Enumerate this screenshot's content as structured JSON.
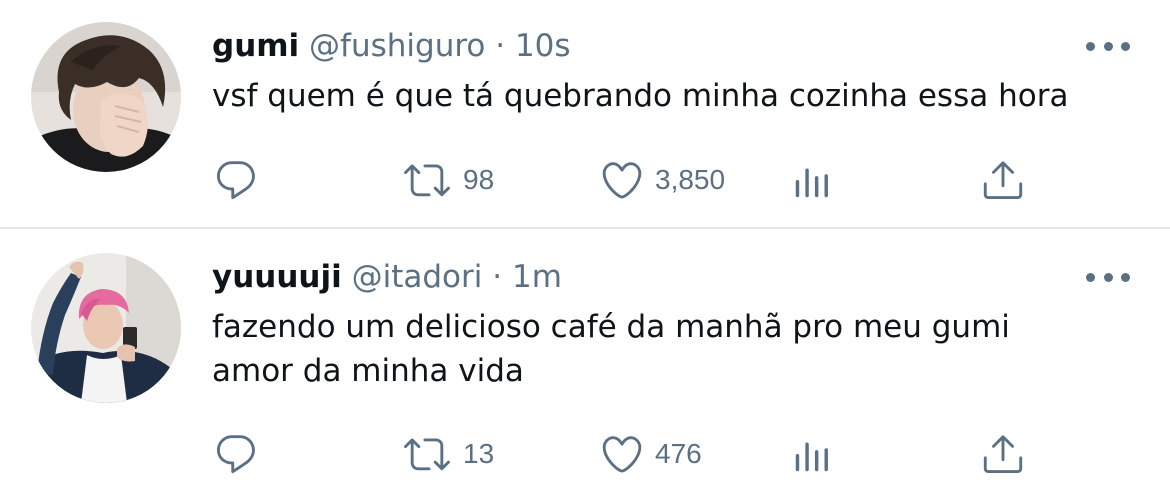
{
  "tweets": [
    {
      "display_name": "gumi",
      "handle": "@fushiguro",
      "separator": "·",
      "time": "10s",
      "text": "vsf quem é que tá quebrando minha cozinha essa hora",
      "retweets": "98",
      "likes": "3,850"
    },
    {
      "display_name": "yuuuuji",
      "handle": "@itadori",
      "separator": "·",
      "time": "1m",
      "text": "fazendo um delicioso café da manhã pro meu gumi amor da minha vida",
      "retweets": "13",
      "likes": "476"
    }
  ],
  "icons": {
    "reply": "speech-bubble-icon",
    "retweet": "retweet-arrows-icon",
    "like": "heart-icon",
    "stats": "bar-chart-icon",
    "share": "share-upload-icon",
    "more": "more-dots-icon"
  },
  "colors": {
    "icon_gray": "#5b7083",
    "divider": "#e3e7ea",
    "text": "#0f1419"
  }
}
